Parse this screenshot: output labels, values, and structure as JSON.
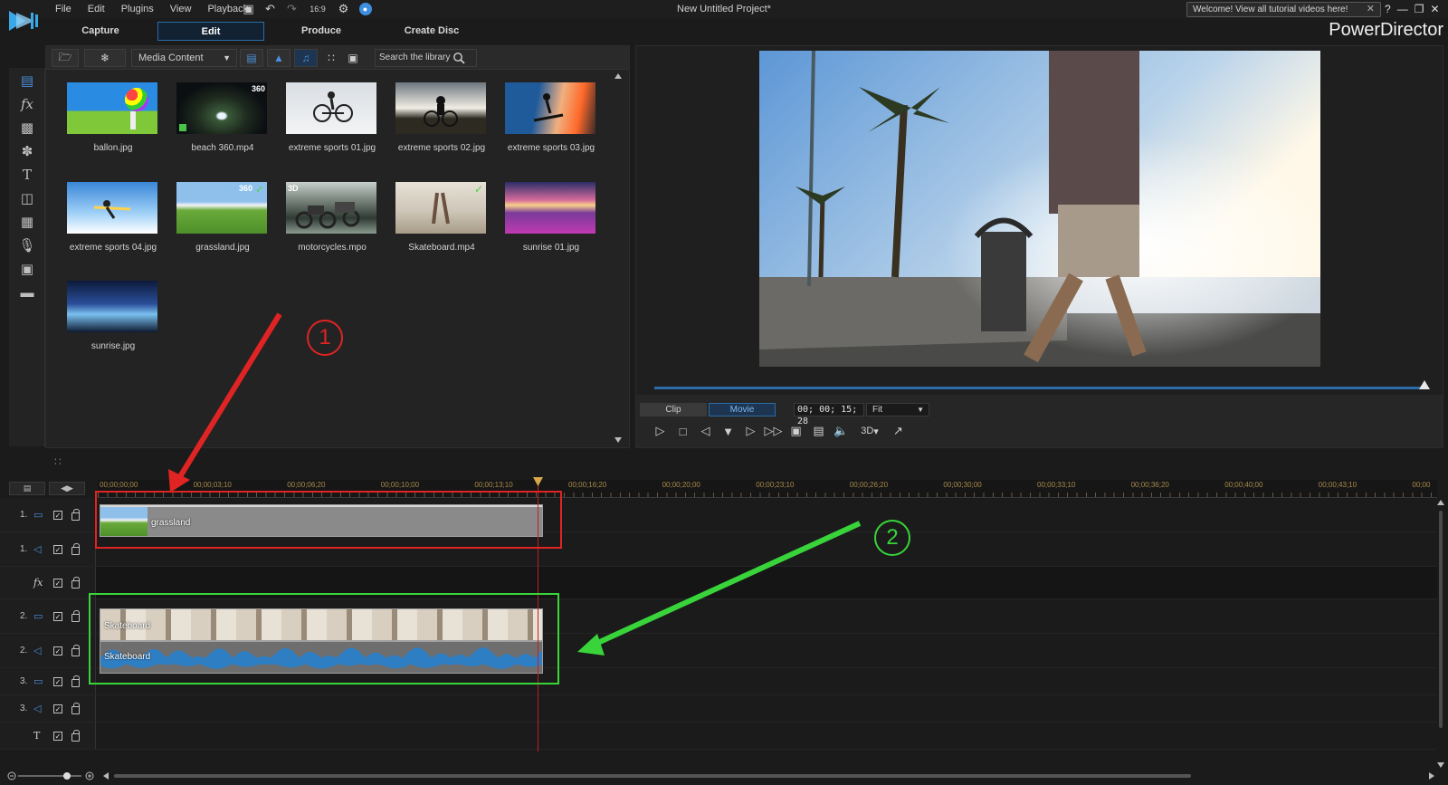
{
  "app": {
    "menu": [
      "File",
      "Edit",
      "Plugins",
      "View",
      "Playback"
    ],
    "project_title": "New Untitled Project*",
    "welcome_text": "Welcome! View all tutorial videos here!",
    "brand": "PowerDirector",
    "aspect": "16:9"
  },
  "modes": [
    "Capture",
    "Edit",
    "Produce",
    "Create Disc"
  ],
  "library": {
    "content_filter": "Media Content",
    "search_placeholder": "Search the library",
    "items": [
      {
        "label": "ballon.jpg"
      },
      {
        "label": "beach 360.mp4",
        "badge": "360"
      },
      {
        "label": "extreme sports 01.jpg"
      },
      {
        "label": "extreme sports 02.jpg"
      },
      {
        "label": "extreme sports 03.jpg"
      },
      {
        "label": "extreme sports 04.jpg"
      },
      {
        "label": "grassland.jpg",
        "badge": "360"
      },
      {
        "label": "motorcycles.mpo",
        "badge": "3D"
      },
      {
        "label": "Skateboard.mp4"
      },
      {
        "label": "sunrise 01.jpg"
      },
      {
        "label": "sunrise.jpg"
      }
    ]
  },
  "preview": {
    "tab_clip": "Clip",
    "tab_movie": "Movie",
    "timecode": "00; 00; 15; 28",
    "fit": "Fit",
    "btn_3d": "3D"
  },
  "timeline": {
    "ticks": [
      "00;00;00;00",
      "00;00;03;10",
      "00;00;06;20",
      "00;00;10;00",
      "00;00;13;10",
      "00;00;16;20",
      "00;00;20;00",
      "00;00;23;10",
      "00;00;26;20",
      "00;00;30;00",
      "00;00;33;10",
      "00;00;36;20",
      "00;00;40;00",
      "00;00;43;10",
      "00;00"
    ],
    "tracks": [
      {
        "num": "1.",
        "kind": "video"
      },
      {
        "num": "1.",
        "kind": "audio"
      },
      {
        "num": "",
        "kind": "fx",
        "icon": "fx"
      },
      {
        "num": "2.",
        "kind": "video"
      },
      {
        "num": "2.",
        "kind": "audio"
      },
      {
        "num": "3.",
        "kind": "video"
      },
      {
        "num": "3.",
        "kind": "audio"
      },
      {
        "num": "",
        "kind": "title",
        "icon": "T"
      }
    ],
    "clip_grassland": "grassland",
    "clip_skate_video": "Skateboard",
    "clip_skate_audio": "Skateboard"
  },
  "annotations": {
    "one": "1",
    "two": "2",
    "color_one": "#e02424",
    "color_two": "#38d43a"
  }
}
